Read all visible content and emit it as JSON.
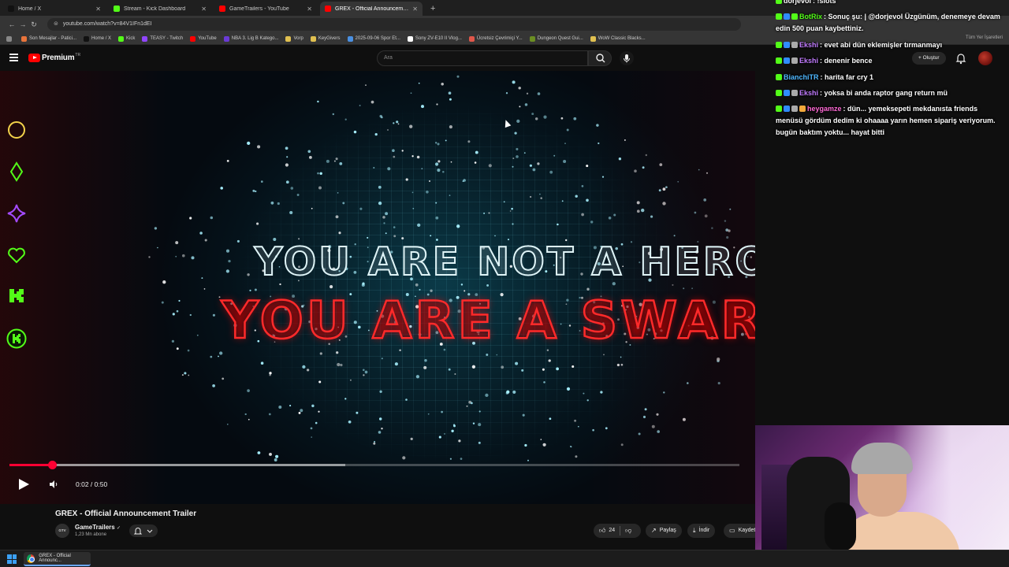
{
  "browser": {
    "tabs": [
      {
        "title": "Home / X",
        "favicon_color": "#111111",
        "active": false
      },
      {
        "title": "Stream - Kick Dashboard",
        "favicon_color": "#53fc18",
        "active": false
      },
      {
        "title": "GameTrailers - YouTube",
        "favicon_color": "#ff0000",
        "active": false
      },
      {
        "title": "GREX - Official Announcement",
        "favicon_color": "#ff0000",
        "active": true
      }
    ],
    "url": "youtube.com/watch?v=84V1IFn1dEI",
    "bookmarks": [
      {
        "label": "Son Mesajlar - Patici...",
        "color": "#e8743b"
      },
      {
        "label": "Home / X",
        "color": "#111111"
      },
      {
        "label": "Kick",
        "color": "#53fc18"
      },
      {
        "label": "TEASY - Twitch",
        "color": "#9146ff"
      },
      {
        "label": "YouTube",
        "color": "#ff0000"
      },
      {
        "label": "NBA 3. Lig B Katego...",
        "color": "#6a3ad6"
      },
      {
        "label": "Vorp",
        "color": "#e0c050"
      },
      {
        "label": "KeyGivers",
        "color": "#e0c050"
      },
      {
        "label": "2025-09-06 Spor Et...",
        "color": "#4a90e2"
      },
      {
        "label": "Sony ZV-E10 II Vlog...",
        "color": "#ffffff"
      },
      {
        "label": "Ücretsiz Çevrimiçi Y...",
        "color": "#e0574a"
      },
      {
        "label": "Dungeon Quest Gui...",
        "color": "#6b8e23"
      },
      {
        "label": "WoW Classic Blacks...",
        "color": "#e0c050"
      }
    ],
    "bookmarks_right": "Tüm Yer İşaretleri"
  },
  "youtube": {
    "logo_text": "Premium",
    "logo_region": "TR",
    "search_placeholder": "Ara",
    "create_label": "+ Oluştur"
  },
  "video": {
    "headline_1": "YOU ARE NOT A HERO",
    "headline_2": "YOU ARE A SWARM",
    "time": "0:02 / 0:50",
    "played_fraction": 0.058,
    "buffered_fraction": 0.46,
    "title": "GREX - Official Announcement Trailer",
    "channel": {
      "name": "GameTrailers",
      "verified_mark": "✓",
      "subscribers": "1,23 Mn abone",
      "avatar_text": "GTV"
    },
    "likes": "24",
    "share_label": "Paylaş",
    "download_label": "İndir",
    "save_label": "Kaydet"
  },
  "side_icons": [
    {
      "name": "circle-icon",
      "color": "#f2d24a"
    },
    {
      "name": "diamond-icon",
      "color": "#53fc18"
    },
    {
      "name": "sparkle-icon",
      "color": "#a44bff"
    },
    {
      "name": "heart-icon",
      "color": "#53fc18"
    },
    {
      "name": "kick-k-icon",
      "color": "#53fc18"
    },
    {
      "name": "kick-circle-icon",
      "color": "#53fc18"
    }
  ],
  "chat": [
    {
      "user": "dorjevol",
      "user_color": "#ffffff",
      "text": ": !slots",
      "badges": [
        "#53fc18"
      ]
    },
    {
      "user": "BotRix",
      "user_color": "#53fc18",
      "text": ": Sonuç şu: | @dorjevol Üzgünüm, denemeye devam edin  500 puan kaybettiniz.",
      "badges": [
        "#53fc18",
        "#2f8cff",
        "#53fc18"
      ]
    },
    {
      "user": "Ekshi",
      "user_color": "#c27cff",
      "text": ": evet abi dün eklemişler tırmanmayı",
      "badges": [
        "#53fc18",
        "#2f8cff",
        "#aaaaaa"
      ]
    },
    {
      "user": "Ekshi",
      "user_color": "#c27cff",
      "text": ": denenir bence",
      "badges": [
        "#53fc18",
        "#2f8cff",
        "#aaaaaa"
      ]
    },
    {
      "user": "BianchiTR",
      "user_color": "#4fb8ff",
      "text": ": harita far cry 1",
      "badges": [
        "#53fc18"
      ]
    },
    {
      "user": "Ekshi",
      "user_color": "#c27cff",
      "text": ": yoksa bi anda raptor gang return mü",
      "badges": [
        "#53fc18",
        "#2f8cff",
        "#aaaaaa"
      ]
    },
    {
      "user": "heygamze",
      "user_color": "#ff6ad5",
      "text": ": dün... yemeksepeti mekdanısta friends menüsü gördüm dedim ki ohaaaa yarın hemen sipariş veriyorum. bugün baktım yoktu... hayat bitti",
      "badges": [
        "#53fc18",
        "#2f8cff",
        "#aaaaaa",
        "#f2a93b"
      ]
    }
  ],
  "taskbar": {
    "app_label": "GREX - Official Announc..."
  }
}
